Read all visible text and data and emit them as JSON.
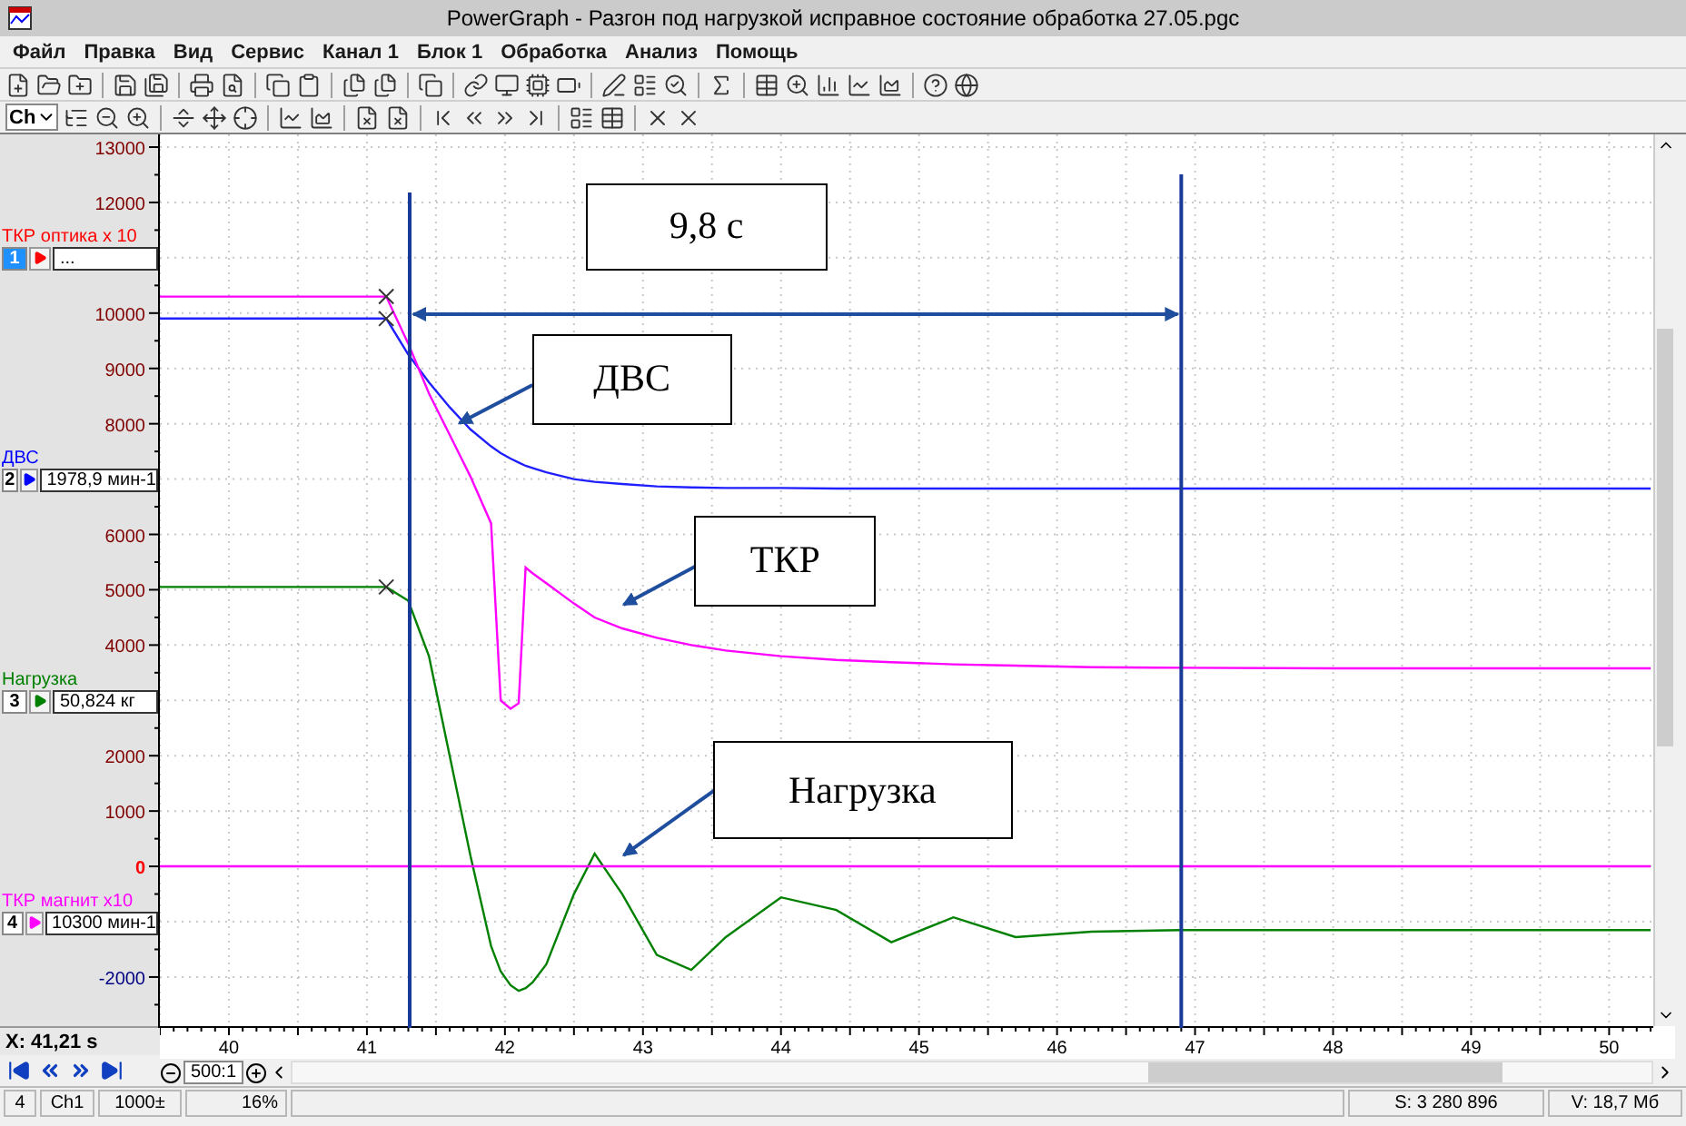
{
  "window": {
    "title": "PowerGraph - Разгон под нагрузкой исправное состояние обработка 27.05.pgc"
  },
  "menu": [
    "Файл",
    "Правка",
    "Вид",
    "Сервис",
    "Канал 1",
    "Блок 1",
    "Обработка",
    "Анализ",
    "Помощь"
  ],
  "toolbar": {
    "channel_selector": "Ch"
  },
  "channels": [
    {
      "number": "1",
      "name": "ТКР оптика x 10",
      "value": "...",
      "color": "#ff0000",
      "selected": true
    },
    {
      "number": "2",
      "name": "ДВС",
      "value": "1978,9 мин-1",
      "color": "#0000ff",
      "selected": false
    },
    {
      "number": "3",
      "name": "Нагрузка",
      "value": "50,824 кг",
      "color": "#008000",
      "selected": false
    },
    {
      "number": "4",
      "name": "ТКР магнит x10",
      "value": "10300 мин-1",
      "color": "#ff00ff",
      "selected": false
    }
  ],
  "plot": {
    "chart_data": {
      "type": "line",
      "x": [
        39.5,
        40,
        41,
        41.14,
        41.3,
        41.45,
        41.6,
        41.75,
        41.9,
        41.97,
        42.04,
        42.1,
        42.15,
        42.2,
        42.3,
        42.5,
        42.65,
        42.85,
        43.1,
        43.35,
        43.6,
        44,
        44.4,
        44.8,
        45.25,
        45.7,
        46.25,
        46.9,
        48,
        49,
        50.3
      ],
      "series": [
        {
          "color": "#2020ff",
          "values": [
            9900,
            9900,
            9900,
            9900,
            9250,
            8750,
            8300,
            7900,
            7590,
            7470,
            7370,
            7300,
            7240,
            7200,
            7120,
            7000,
            6950,
            6910,
            6870,
            6850,
            6840,
            6840,
            6830,
            6830,
            6830,
            6830,
            6830,
            6830,
            6830,
            6830,
            6830
          ]
        },
        {
          "color": "#ff00ff",
          "values": [
            10300,
            10300,
            10300,
            10300,
            9450,
            8550,
            7800,
            7050,
            6200,
            3000,
            2850,
            2950,
            5400,
            5300,
            5120,
            4750,
            4500,
            4300,
            4130,
            4000,
            3900,
            3800,
            3730,
            3690,
            3650,
            3630,
            3600,
            3590,
            3580,
            3580,
            3580
          ]
        },
        {
          "color": "#008000",
          "values": [
            5050,
            5050,
            5050,
            5050,
            4800,
            3800,
            2000,
            200,
            -1440,
            -1900,
            -2150,
            -2250,
            -2200,
            -2100,
            -1770,
            -500,
            230,
            -500,
            -1600,
            -1870,
            -1280,
            -560,
            -790,
            -1370,
            -920,
            -1280,
            -1180,
            -1150,
            -1150,
            -1150,
            -1150
          ]
        },
        {
          "color": "#ff00ff",
          "values": [
            0,
            0,
            0,
            0,
            0,
            0,
            0,
            0,
            0,
            0,
            0,
            0,
            0,
            0,
            0,
            0,
            0,
            0,
            0,
            0,
            0,
            0,
            0,
            0,
            0,
            0,
            0,
            0,
            0,
            0,
            0
          ]
        }
      ],
      "xlim": [
        39.5,
        50.32
      ],
      "ylim": [
        -2920,
        13230
      ],
      "grid": true,
      "ref_lines": [
        {
          "axis": "x",
          "value": 41.31
        },
        {
          "axis": "x",
          "value": 46.9
        }
      ],
      "xticks": [
        40,
        41,
        42,
        43,
        44,
        45,
        46,
        47,
        48,
        49,
        50
      ],
      "yticks": [
        13000,
        12000,
        10000,
        9000,
        8000,
        6000,
        5000,
        4000,
        2000,
        1000,
        0,
        -2000
      ],
      "annotations": [
        "9,8 с",
        "ДВС",
        "ТКР",
        "Нагрузка"
      ]
    }
  },
  "cursor_readout": "X: 41,21 s",
  "zoom": {
    "scale": "500:1"
  },
  "status_bar": [
    "4",
    "Ch1",
    "1000±",
    "16%",
    "S: 3 280 896",
    "V: 18,7 Мб"
  ]
}
